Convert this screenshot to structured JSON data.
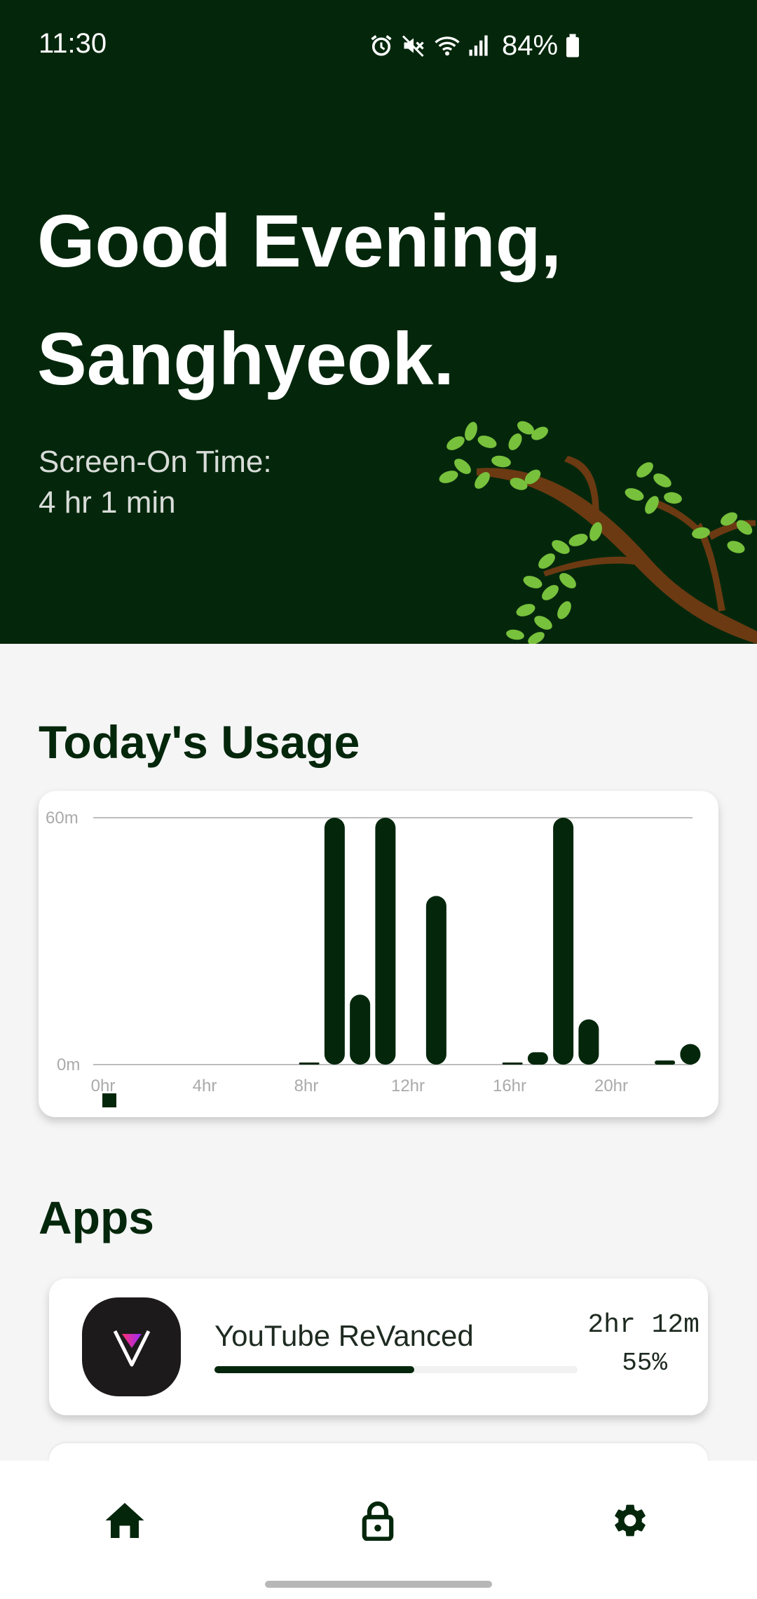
{
  "status_bar": {
    "time": "11:30",
    "battery": "84%",
    "icons": [
      "alarm-icon",
      "mute-icon",
      "wifi-icon",
      "signal-icon",
      "battery-icon"
    ]
  },
  "header": {
    "greeting_line1": "Good Evening,",
    "greeting_line2": "Sanghyeok.",
    "screen_on_label": "Screen-On Time:",
    "screen_on_value": "4 hr 1 min",
    "background_color": "#04270c"
  },
  "usage": {
    "title": "Today's Usage"
  },
  "chart_data": {
    "type": "bar",
    "y_labels": [
      "60m",
      "0m"
    ],
    "ylim": [
      0,
      60
    ],
    "x_tick_labels": [
      "0hr",
      "4hr",
      "8hr",
      "12hr",
      "16hr",
      "20hr"
    ],
    "categories": [
      0,
      1,
      2,
      3,
      4,
      5,
      6,
      7,
      8,
      9,
      10,
      11,
      12,
      13,
      14,
      15,
      16,
      17,
      18,
      19,
      20,
      21,
      22,
      23
    ],
    "values": [
      0,
      0,
      0,
      0,
      0,
      0,
      0,
      0,
      0.5,
      60,
      17,
      60,
      0,
      41,
      0,
      0,
      0.5,
      3,
      60,
      11,
      0,
      0,
      1,
      5
    ],
    "bar_color": "#04270c",
    "legend": "bottom-left"
  },
  "apps": {
    "title": "Apps",
    "items": [
      {
        "name": "YouTube ReVanced",
        "time": "2hr 12m",
        "percent": "55%",
        "progress": 0.55
      }
    ]
  },
  "nav": {
    "items": [
      {
        "icon": "home-icon"
      },
      {
        "icon": "lock-icon"
      },
      {
        "icon": "gear-icon"
      }
    ]
  }
}
